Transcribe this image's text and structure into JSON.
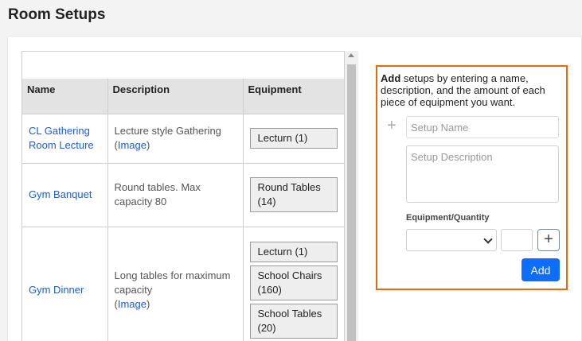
{
  "page": {
    "title": "Room Setups"
  },
  "table": {
    "columns": [
      "Name",
      "Description",
      "Equipment"
    ],
    "rows": [
      {
        "name": "CL Gathering Room Lecture",
        "description": "Lecture style Gathering",
        "image_link": "Image",
        "equipment": [
          "Lecturn (1)"
        ]
      },
      {
        "name": "Gym Banquet",
        "description": "Round tables. Max capacity 80",
        "image_link": "",
        "equipment": [
          "Round Tables (14)"
        ]
      },
      {
        "name": "Gym Dinner",
        "description": "Long tables for maximum capacity",
        "image_link": "Image",
        "equipment": [
          "Lecturn (1)",
          "School Chairs (160)",
          "School Tables (20)"
        ]
      }
    ]
  },
  "add_panel": {
    "instruction_bold": "Add",
    "instruction_rest": " setups by entering a name, description, and the amount of each piece of equipment you want.",
    "plus_symbol": "+",
    "name_placeholder": "Setup Name",
    "description_placeholder": "Setup Description",
    "equipment_label": "Equipment/Quantity",
    "equipment_select_value": "",
    "quantity_value": "",
    "add_equipment_symbol": "+",
    "add_button_label": "Add"
  },
  "colors": {
    "link": "#1a5fd0",
    "panel_border": "#e8690c",
    "primary_button": "#0d6efd"
  }
}
